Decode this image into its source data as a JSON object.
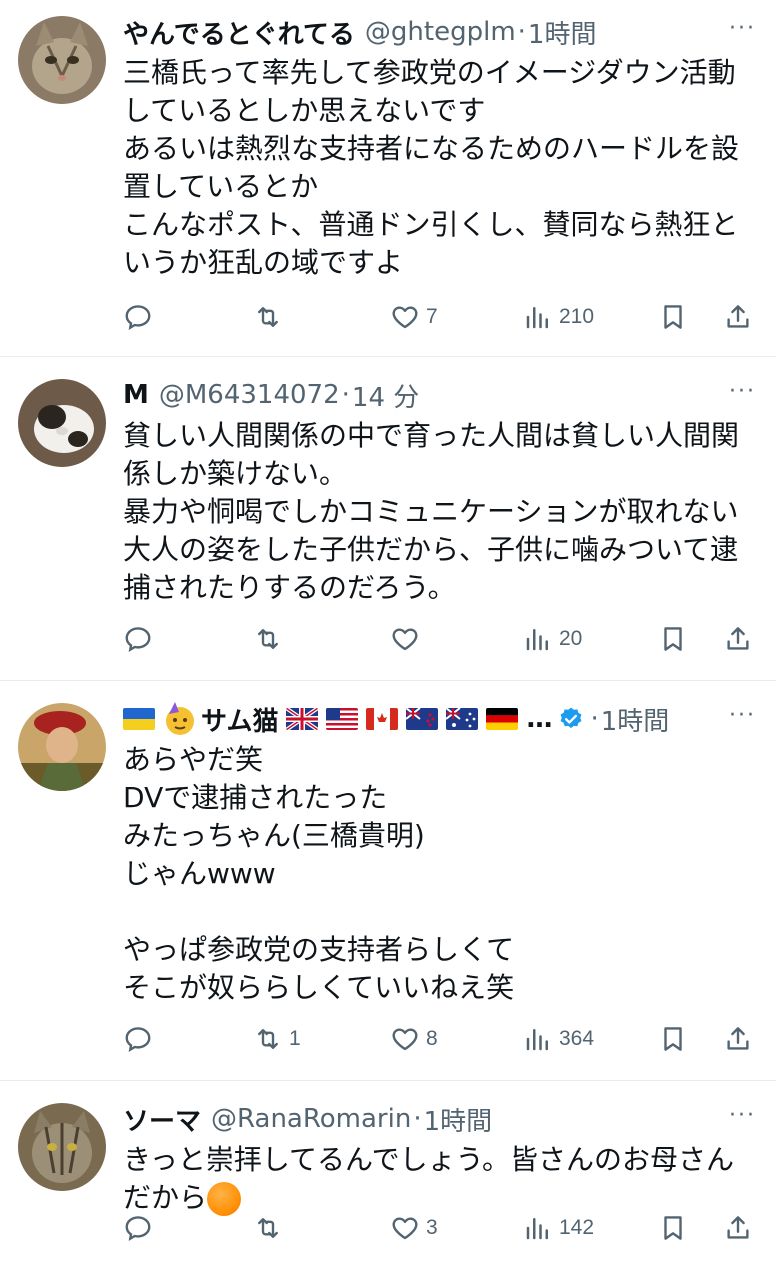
{
  "icons": {
    "reply": "reply-icon",
    "repost": "repost-icon",
    "like": "like-icon",
    "views": "views-icon",
    "bookmark": "bookmark-icon",
    "share": "share-icon",
    "more": "more-icon"
  },
  "more_label": "···",
  "tweets": [
    {
      "name": "やんでるとぐれてる",
      "handle": "@ghtegplm",
      "sep": "·",
      "time": "1時間",
      "text": "三橋氏って率先して参政党のイメージダウン活動\nしているとしか思えないです\nあるいは熱烈な支持者になるためのハードルを設\n置しているとか\nこんなポスト、普通ドン引くし、賛同なら熱狂と\nいうか狂乱の域ですよ",
      "replies": "",
      "reposts": "",
      "likes": "7",
      "views": "210"
    },
    {
      "name": "M",
      "handle": "@M64314072",
      "sep": "·",
      "time": "14 分",
      "text": "貧しい人間関係の中で育った人間は貧しい人間関\n係しか築けない。\n暴力や恫喝でしかコミュニケーションが取れない\n大人の姿をした子供だから、子供に噛みついて逮\n捕されたりするのだろう。",
      "replies": "",
      "reposts": "",
      "likes": "",
      "views": "20"
    },
    {
      "name": "サム猫",
      "name_suffix": "…",
      "handle": "",
      "sep": "·",
      "time": "1時間",
      "text": "あらやだ笑\nDVで逮捕されたった\nみたっちゃん(三橋貴明)\nじゃんwww\n\nやっぱ参政党の支持者らしくて\nそこが奴ららしくていいねえ笑",
      "replies": "",
      "reposts": "1",
      "likes": "8",
      "views": "364"
    },
    {
      "name": "ソーマ",
      "handle": "@RanaRomarin",
      "sep": "·",
      "time": "1時間",
      "text": "きっと崇拝してるんでしょう。皆さんのお母さん\nだから",
      "replies": "",
      "reposts": "",
      "likes": "3",
      "views": "142"
    }
  ]
}
